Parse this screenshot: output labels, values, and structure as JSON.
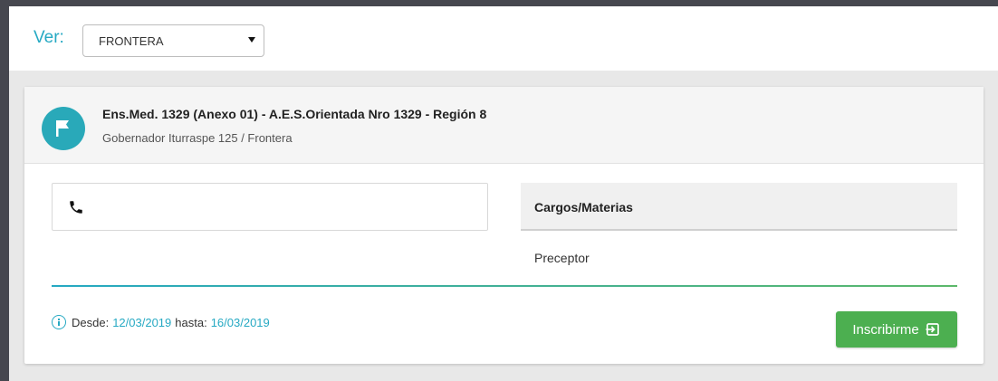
{
  "filter": {
    "label": "Ver:",
    "selected": "FRONTERA"
  },
  "school": {
    "title": "Ens.Med. 1329 (Anexo 01) - A.E.S.Orientada Nro 1329 - Región 8",
    "address": "Gobernador Iturraspe 125 / Frontera",
    "icon": "flag-icon"
  },
  "contact": {
    "icon": "phone-icon",
    "phone": ""
  },
  "subjects": {
    "header": "Cargos/Materias",
    "items": [
      "Preceptor"
    ]
  },
  "period": {
    "from_label": "Desde:",
    "from": "12/03/2019",
    "to_label": "hasta:",
    "to": "16/03/2019"
  },
  "actions": {
    "enroll_label": "Inscribirme"
  },
  "colors": {
    "accent": "#26a9c3",
    "success": "#4caf50"
  }
}
